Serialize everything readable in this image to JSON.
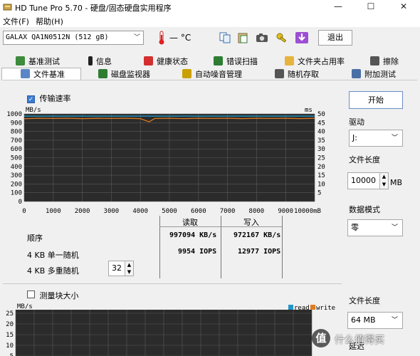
{
  "window": {
    "title": "HD Tune Pro 5.70 - 硬盘/固态硬盘实用程序",
    "min": "—",
    "max": "☐",
    "close": "✕"
  },
  "menu": [
    "文件(F)",
    "帮助(H)"
  ],
  "toolbar": {
    "drive": "GALAX QA1N0512N (512 gB)",
    "temp": "— °C",
    "exit": "退出",
    "icons": [
      "thermometer-icon",
      "copy-icon",
      "paste-icon",
      "camera-icon",
      "keys-icon",
      "download-icon"
    ]
  },
  "tabs_row1": [
    {
      "label": "基准测试",
      "icon": "speed-icon"
    },
    {
      "label": "信息",
      "icon": "info-icon"
    },
    {
      "label": "健康状态",
      "icon": "health-icon"
    },
    {
      "label": "错误扫描",
      "icon": "scan-icon"
    },
    {
      "label": "文件夹占用率",
      "icon": "folder-icon"
    },
    {
      "label": "擦除",
      "icon": "erase-icon"
    }
  ],
  "tabs_row2": [
    {
      "label": "文件基准",
      "icon": "file-icon",
      "selected": true
    },
    {
      "label": "磁盘监视器",
      "icon": "monitor-icon"
    },
    {
      "label": "自动噪音管理",
      "icon": "speaker-icon"
    },
    {
      "label": "随机存取",
      "icon": "random-icon"
    },
    {
      "label": "附加测试",
      "icon": "extra-icon"
    }
  ],
  "benchmark": {
    "transfer_rate_label": "传输速率",
    "transfer_rate_checked": true,
    "unit_left": "MB/s",
    "unit_right": "ms",
    "y_left": [
      "1000",
      "900",
      "800",
      "700",
      "600",
      "500",
      "400",
      "300",
      "200",
      "100",
      "0"
    ],
    "y_right": [
      "50",
      "45",
      "40",
      "35",
      "30",
      "25",
      "20",
      "15",
      "10",
      "5"
    ],
    "x": [
      "0",
      "1000",
      "2000",
      "3000",
      "4000",
      "5000",
      "6000",
      "7000",
      "8000",
      "9000",
      "10000mB"
    ],
    "col_read": "读取",
    "col_write": "写入",
    "rows": [
      {
        "label": "顺序",
        "read": "997094 KB/s",
        "write": "972167 KB/s"
      },
      {
        "label": "4 KB 单一随机",
        "read": "9954 IOPS",
        "write": "12977 IOPS"
      },
      {
        "label": "4 KB 多重随机",
        "read": "",
        "write": "",
        "queue": "32"
      }
    ]
  },
  "blocksize": {
    "label": "测量块大小",
    "checked": false,
    "unit": "MB/s",
    "y": [
      "25",
      "20",
      "15",
      "10",
      "5"
    ],
    "legend_read": "read",
    "legend_write": "write"
  },
  "sidebar": {
    "start": "开始",
    "drive_label": "驱动",
    "drive_value": "J:",
    "file_length_label": "文件长度",
    "file_length_value": "10000",
    "file_length_unit": "MB",
    "data_mode_label": "数据模式",
    "data_mode_value": "零",
    "file_length2_label": "文件长度",
    "file_length2_value": "64 MB",
    "delay_label": "延迟"
  },
  "watermark": "什么值得买",
  "colors": {
    "chart_bg": "#2b2b2b",
    "grid": "#5a5a5a",
    "read": "#2196c9",
    "write": "#e07b20",
    "accent": "#3c7bd0"
  },
  "chart_data": {
    "type": "line",
    "xlabel": "",
    "ylabel": "MB/s",
    "xlim": [
      0,
      10000
    ],
    "ylim": [
      0,
      1000
    ],
    "y2lim": [
      0,
      50
    ],
    "x": [
      0,
      500,
      1000,
      1500,
      2000,
      2500,
      3000,
      3500,
      4000,
      4300,
      4500,
      5000,
      5500,
      6000,
      6500,
      7000,
      7500,
      8000,
      8500,
      9000,
      9500,
      10000
    ],
    "series": [
      {
        "name": "read",
        "values": [
          975,
          975,
          975,
          975,
          975,
          975,
          975,
          975,
          975,
          975,
          975,
          975,
          975,
          975,
          975,
          975,
          975,
          975,
          975,
          975,
          975,
          975
        ]
      },
      {
        "name": "write",
        "values": [
          945,
          950,
          948,
          950,
          946,
          950,
          948,
          950,
          946,
          910,
          948,
          950,
          946,
          950,
          948,
          950,
          946,
          950,
          948,
          950,
          946,
          950
        ]
      }
    ]
  }
}
